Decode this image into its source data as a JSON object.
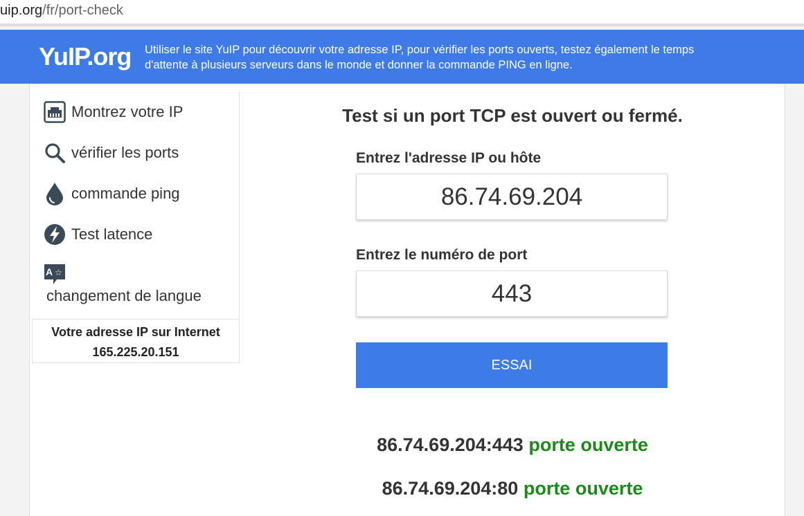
{
  "browser": {
    "url_host": "uip.org",
    "url_path": "/fr/port-check"
  },
  "header": {
    "logo": "YuIP.org",
    "tagline_line1": "Utiliser le site YuIP pour découvrir votre adresse IP, pour vérifier les ports ouverts, testez également le temps",
    "tagline_line2": "d'attente à plusieurs serveurs dans le monde et donner la commande PING en ligne."
  },
  "sidebar": {
    "items": [
      {
        "label": "Montrez votre IP",
        "icon": "network-port-icon"
      },
      {
        "label": "vérifier les ports",
        "icon": "search-icon"
      },
      {
        "label": "commande ping",
        "icon": "drop-icon"
      },
      {
        "label": "Test latence",
        "icon": "lightning-icon"
      }
    ],
    "language": {
      "label": "changement de langue",
      "icon": "translate-icon"
    },
    "ip_box": {
      "title": "Votre adresse IP sur Internet",
      "ip": "165.225.20.151"
    }
  },
  "main": {
    "title": "Test si un port TCP est ouvert ou fermé.",
    "host_label": "Entrez l'adresse IP ou hôte",
    "host_value": "86.74.69.204",
    "port_label": "Entrez le numéro de port",
    "port_value": "443",
    "button_label": "ESSAI",
    "results": [
      {
        "target": "86.74.69.204:443",
        "status": "porte ouverte"
      },
      {
        "target": "86.74.69.204:80",
        "status": "porte ouverte"
      }
    ]
  },
  "colors": {
    "header_bg": "#3f7be6",
    "button_bg": "#3d7be6",
    "status_open": "#1b8a1b"
  }
}
